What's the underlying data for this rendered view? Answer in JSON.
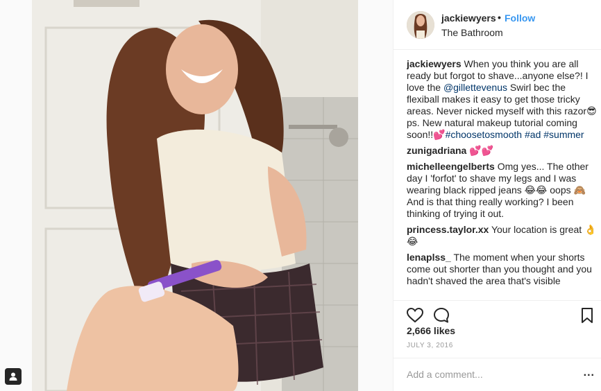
{
  "post": {
    "username": "jackiewyers",
    "follow_separator": "•",
    "follow_label": "Follow",
    "location": "The Bathroom"
  },
  "comments": [
    {
      "username": "jackiewyers",
      "text_parts": [
        "When you think you are all ready but forgot to shave...anyone else?! I love the ",
        "@gillettevenus",
        " Swirl bec the flexiball makes it easy to get those tricky areas. Never nicked myself with this razor😎ps. New natural makeup tutorial coming soon!!💕",
        "#choosetosmooth",
        " ",
        "#ad",
        " ",
        "#summer"
      ]
    },
    {
      "username": "zunigadriana",
      "text": "💕💕"
    },
    {
      "username": "michelleengelberts",
      "text": "Omg yes... The other day I 'forfot' to shave my legs and I was wearing black ripped jeans 😂😂 oops 🙈 And is that thing really working? I been thinking of trying it out."
    },
    {
      "username": "princess.taylor.xx",
      "text": "Your location is great 👌😂"
    },
    {
      "username": "lenaplss_",
      "text": "The moment when your shorts come out shorter than you thought and you hadn't shaved the area that's visible"
    }
  ],
  "likes_text": "2,666 likes",
  "date_text": "JULY 3, 2016",
  "add_comment_placeholder": "Add a comment...",
  "more_label": "...",
  "icons": {
    "like": "heart-icon",
    "comment": "comment-bubble-icon",
    "save": "bookmark-icon",
    "tag": "person-tag-icon"
  },
  "colors": {
    "link_blue": "#3897f0",
    "hashtag": "#003569",
    "text": "#262626",
    "muted": "#999999"
  }
}
